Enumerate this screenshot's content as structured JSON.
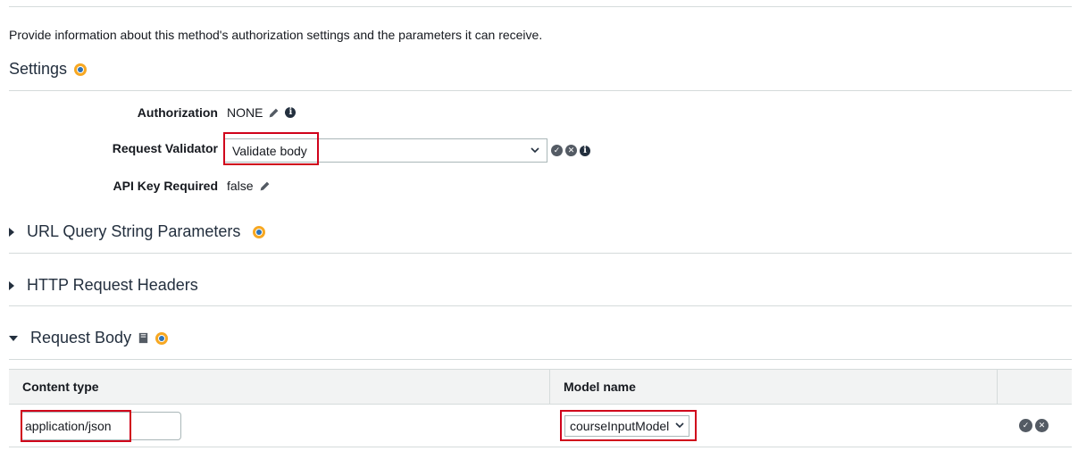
{
  "intro_text": "Provide information about this method's authorization settings and the parameters it can receive.",
  "settings": {
    "title": "Settings",
    "authorization_label": "Authorization",
    "authorization_value": "NONE",
    "request_validator_label": "Request Validator",
    "request_validator_value": "Validate body",
    "api_key_label": "API Key Required",
    "api_key_value": "false"
  },
  "sections": {
    "url_query": "URL Query String Parameters",
    "http_headers": "HTTP Request Headers",
    "request_body": "Request Body"
  },
  "table": {
    "col_content_type": "Content type",
    "col_model_name": "Model name",
    "row": {
      "content_type": "application/json",
      "model_name": "courseInputModel"
    }
  },
  "colors": {
    "highlight": "#d0021b",
    "accent_orange": "#f7a823"
  },
  "icons": [
    "pencil-icon",
    "info-icon",
    "check-icon",
    "cancel-icon",
    "book-icon",
    "chevron-down-icon",
    "caret-right-icon",
    "caret-down-icon",
    "orange-badge-icon"
  ]
}
